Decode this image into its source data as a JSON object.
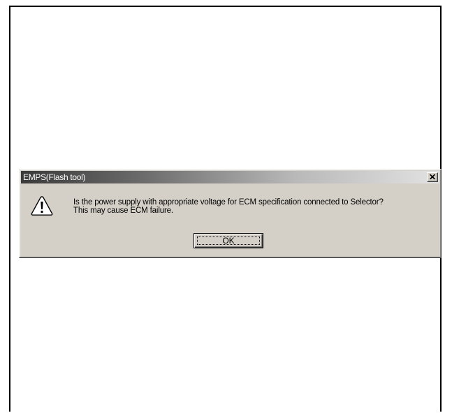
{
  "dialog": {
    "title": "EMPS(Flash tool)",
    "close_label": "×",
    "icon": "warning-icon",
    "message_line1": "Is the power supply with appropriate voltage for ECM specification connected to Selector?",
    "message_line2": "This may cause ECM failure.",
    "ok_label": "OK"
  },
  "colors": {
    "dialog_face": "#d4d0c8",
    "titlebar_start": "#3a3a3a",
    "titlebar_end": "#e2e2e2",
    "title_text": "#ffffff"
  }
}
